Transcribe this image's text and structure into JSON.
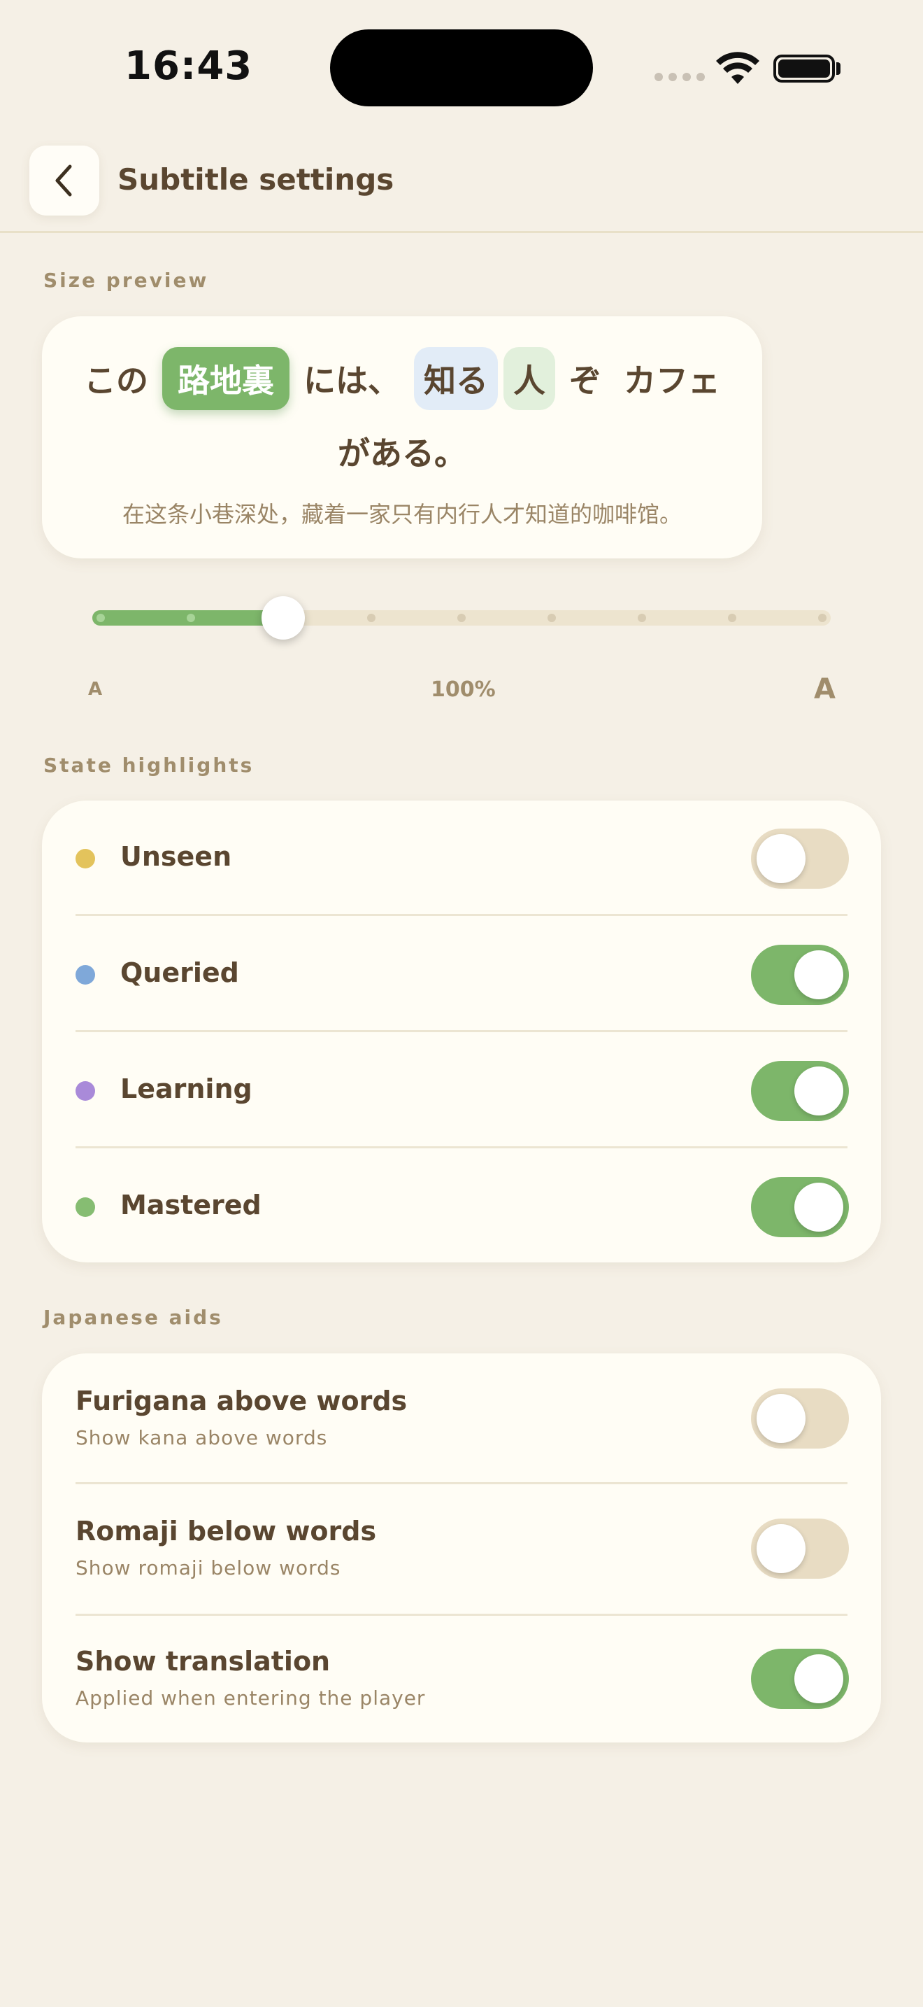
{
  "status_bar": {
    "time": "16:43"
  },
  "header": {
    "title": "Subtitle settings"
  },
  "size_preview": {
    "section_label": "Size preview",
    "line1": [
      {
        "text": "この",
        "state": "plain"
      },
      {
        "text": "路地裏",
        "state": "mastered"
      },
      {
        "text": "には、",
        "state": "plain"
      },
      {
        "text": "知る",
        "state": "queried"
      },
      {
        "text": "人",
        "state": "learning"
      },
      {
        "text": "ぞ",
        "state": "plain"
      },
      {
        "text": "カフェ",
        "state": "plain"
      }
    ],
    "line2": "がある。",
    "translation": "在这条小巷深处，藏着一家只有内行人才知道的咖啡馆。",
    "slider": {
      "small_label": "A",
      "value_label": "100%",
      "large_label": "A",
      "step_count": 9,
      "selected_step": 2
    }
  },
  "state_highlights": {
    "section_label": "State highlights",
    "items": [
      {
        "label": "Unseen",
        "color": "#e3c35c",
        "enabled": false
      },
      {
        "label": "Queried",
        "color": "#7fa8d9",
        "enabled": true
      },
      {
        "label": "Learning",
        "color": "#a98ad9",
        "enabled": true
      },
      {
        "label": "Mastered",
        "color": "#86bd72",
        "enabled": true
      }
    ]
  },
  "japanese_aids": {
    "section_label": "Japanese aids",
    "items": [
      {
        "title": "Furigana above words",
        "subtitle": "Show kana above words",
        "enabled": false
      },
      {
        "title": "Romaji below words",
        "subtitle": "Show romaji below words",
        "enabled": false
      },
      {
        "title": "Show translation",
        "subtitle": "Applied when entering the player",
        "enabled": true
      }
    ]
  },
  "colors": {
    "accent_green": "#7db66a",
    "background": "#f5f0e6",
    "card": "#fffdf5"
  }
}
